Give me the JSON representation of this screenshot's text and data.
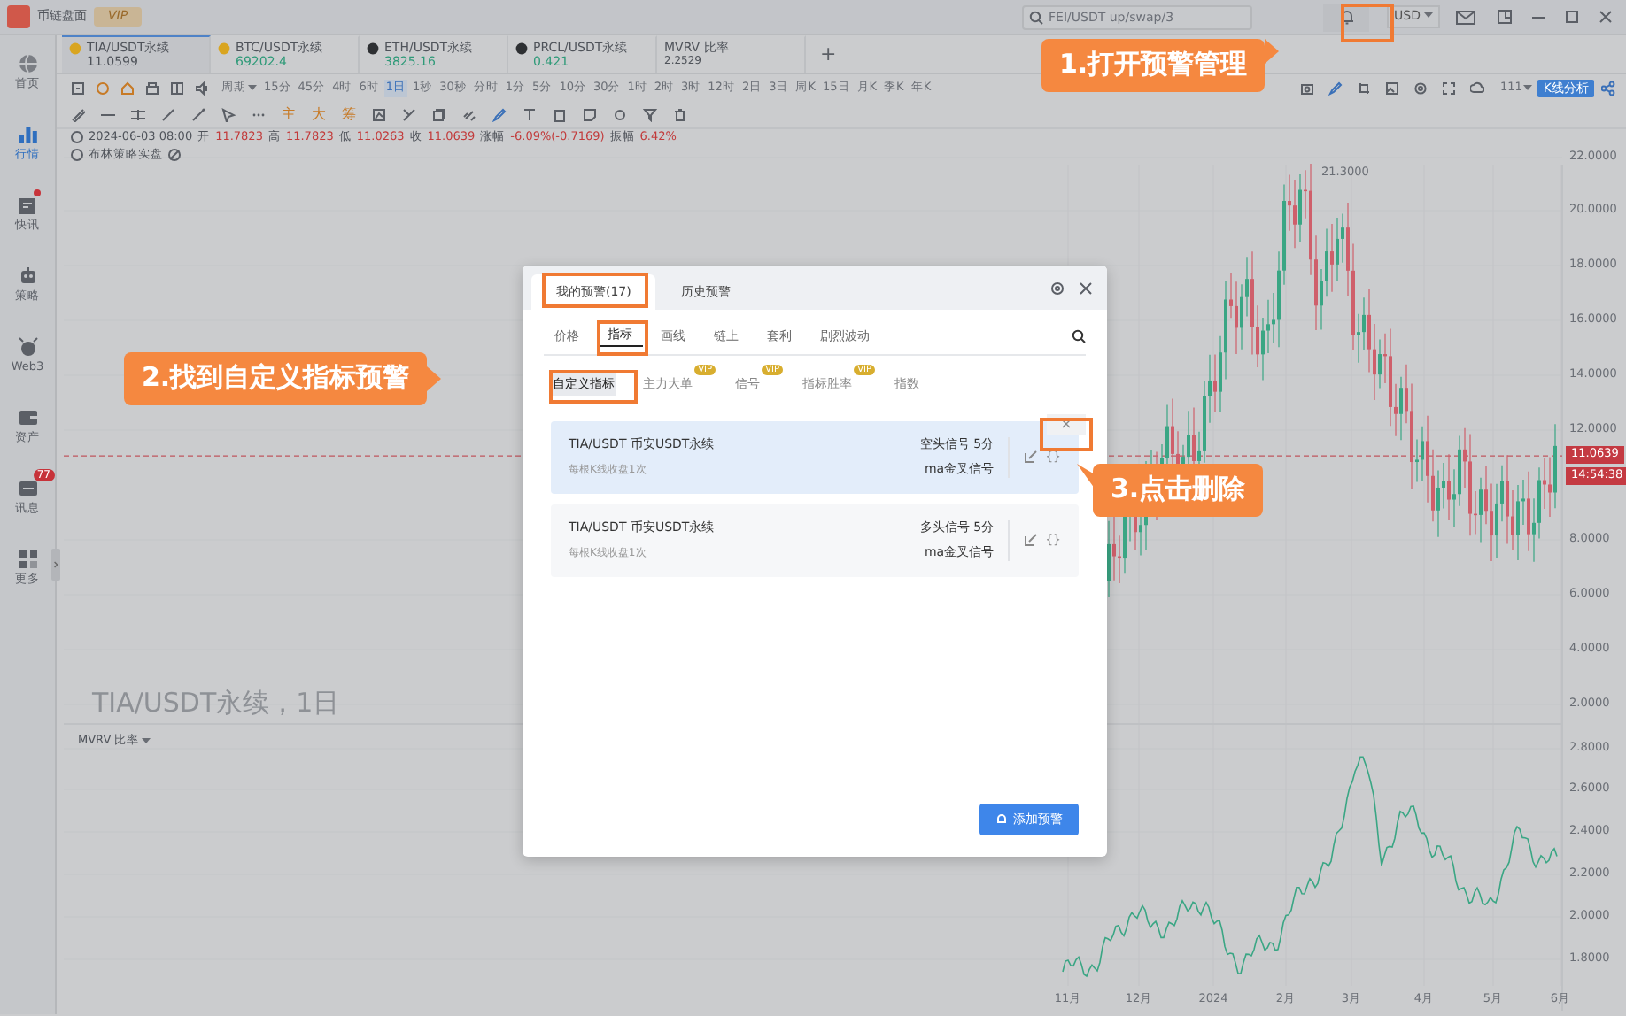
{
  "app": {
    "name": "币链盘面",
    "vip": "VIP"
  },
  "search": {
    "placeholder": "FEI/USDT up/swap/3"
  },
  "currency": "USD",
  "sidebar": [
    {
      "label": "首页",
      "selected": false,
      "unread": false
    },
    {
      "label": "行情",
      "selected": true,
      "unread": false
    },
    {
      "label": "快讯",
      "selected": false,
      "unread": true
    },
    {
      "label": "策略",
      "selected": false,
      "unread": false
    },
    {
      "label": "Web3",
      "selected": false,
      "unread": false
    },
    {
      "label": "资产",
      "selected": false,
      "unread": false
    },
    {
      "label": "讯息",
      "selected": false,
      "unread": false,
      "badge": "77"
    },
    {
      "label": "更多",
      "selected": false,
      "unread": false
    }
  ],
  "ticker_tabs": [
    {
      "kind": "coin",
      "symbol": "TIA/USDT永续",
      "price": "11.0599",
      "selected": true,
      "rising": false,
      "color": "#d9a520"
    },
    {
      "kind": "coin",
      "symbol": "BTC/USDT永续",
      "price": "69202.4",
      "selected": false,
      "rising": true,
      "color": "#d9a520"
    },
    {
      "kind": "coin",
      "symbol": "ETH/USDT永续",
      "price": "3825.16",
      "selected": false,
      "rising": true,
      "color": "#2e3033"
    },
    {
      "kind": "coin",
      "symbol": "PRCL/USDT永续",
      "price": "0.421",
      "selected": false,
      "rising": true,
      "color": "#2e3033"
    },
    {
      "kind": "metric",
      "symbol": "MVRV 比率",
      "price": "2.2529",
      "selected": false,
      "rising": false
    }
  ],
  "add_tab": "+",
  "period_menu": "周期",
  "periods": [
    {
      "label": "15分",
      "selected": false
    },
    {
      "label": "45分",
      "selected": false
    },
    {
      "label": "4时",
      "selected": false
    },
    {
      "label": "6时",
      "selected": false
    },
    {
      "label": "1日",
      "selected": true
    },
    {
      "label": "1秒",
      "selected": false
    },
    {
      "label": "30秒",
      "selected": false
    },
    {
      "label": "分时",
      "selected": false
    },
    {
      "label": "1分",
      "selected": false
    },
    {
      "label": "5分",
      "selected": false
    },
    {
      "label": "10分",
      "selected": false
    },
    {
      "label": "30分",
      "selected": false
    },
    {
      "label": "1时",
      "selected": false
    },
    {
      "label": "2时",
      "selected": false
    },
    {
      "label": "3时",
      "selected": false
    },
    {
      "label": "12时",
      "selected": false
    },
    {
      "label": "2日",
      "selected": false
    },
    {
      "label": "3日",
      "selected": false
    },
    {
      "label": "周K",
      "selected": false
    },
    {
      "label": "15日",
      "selected": false
    },
    {
      "label": "月K",
      "selected": false
    },
    {
      "label": "季K",
      "selected": false
    },
    {
      "label": "年K",
      "selected": false
    }
  ],
  "layout_count": "111",
  "analysis_button": "K线分析",
  "tool_chars": [
    "主",
    "大",
    "筹"
  ],
  "quote": {
    "time": "2024-06-03 08:00",
    "fields": [
      {
        "label": "开",
        "value": "11.7823"
      },
      {
        "label": "高",
        "value": "11.7823"
      },
      {
        "label": "低",
        "value": "11.0263"
      },
      {
        "label": "收",
        "value": "11.0639"
      },
      {
        "label": "涨幅",
        "value": "-6.09%(-0.7169)"
      },
      {
        "label": "振幅",
        "value": "6.42%"
      }
    ]
  },
  "strategy": "布林策略实盘",
  "watermark": "TIA/USDT永续，1日",
  "price_axis": [
    "22.0000",
    "20.0000",
    "18.0000",
    "16.0000",
    "14.0000",
    "12.0000",
    "8.0000",
    "6.0000",
    "4.0000",
    "2.0000"
  ],
  "peak_label": "21.3000",
  "price_tag": "11.0639",
  "time_tag": "14:54:38",
  "indicator": "MVRV 比率",
  "indicator_axis": [
    "2.8000",
    "2.6000",
    "2.4000",
    "2.2000",
    "2.0000",
    "1.8000"
  ],
  "time_axis": [
    "11月",
    "12月",
    "2024",
    "2月",
    "3月",
    "4月",
    "5月",
    "6月"
  ],
  "alert_modal": {
    "tabs": [
      {
        "label": "我的预警(17)",
        "selected": true
      },
      {
        "label": "历史预警",
        "selected": false
      }
    ],
    "categories": [
      {
        "label": "价格",
        "selected": false
      },
      {
        "label": "指标",
        "selected": true
      },
      {
        "label": "画线",
        "selected": false
      },
      {
        "label": "链上",
        "selected": false
      },
      {
        "label": "套利",
        "selected": false
      },
      {
        "label": "剧烈波动",
        "selected": false
      }
    ],
    "subtabs": [
      {
        "label": "自定义指标",
        "selected": true
      },
      {
        "label": "主力大单",
        "selected": false,
        "badge": "VIP"
      },
      {
        "label": "信号",
        "selected": false,
        "badge": "VIP"
      },
      {
        "label": "指标胜率",
        "selected": false,
        "badge": "VIP"
      },
      {
        "label": "指数",
        "selected": false
      }
    ],
    "alerts": [
      {
        "market": "TIA/USDT  币安USDT永续",
        "frequency": "每根K线收盘1次",
        "signal": "空头信号 5分",
        "indicator": "ma金叉信号",
        "hovered": true,
        "delete": "×",
        "code": "{}"
      },
      {
        "market": "TIA/USDT  币安USDT永续",
        "frequency": "每根K线收盘1次",
        "signal": "多头信号 5分",
        "indicator": "ma金叉信号",
        "hovered": false,
        "code": "{}"
      }
    ],
    "add_button": "添加预警"
  },
  "callouts": [
    {
      "text": "1.打开预警管理"
    },
    {
      "text": "2.找到自定义指标预警"
    },
    {
      "text": "3.点击删除"
    }
  ]
}
